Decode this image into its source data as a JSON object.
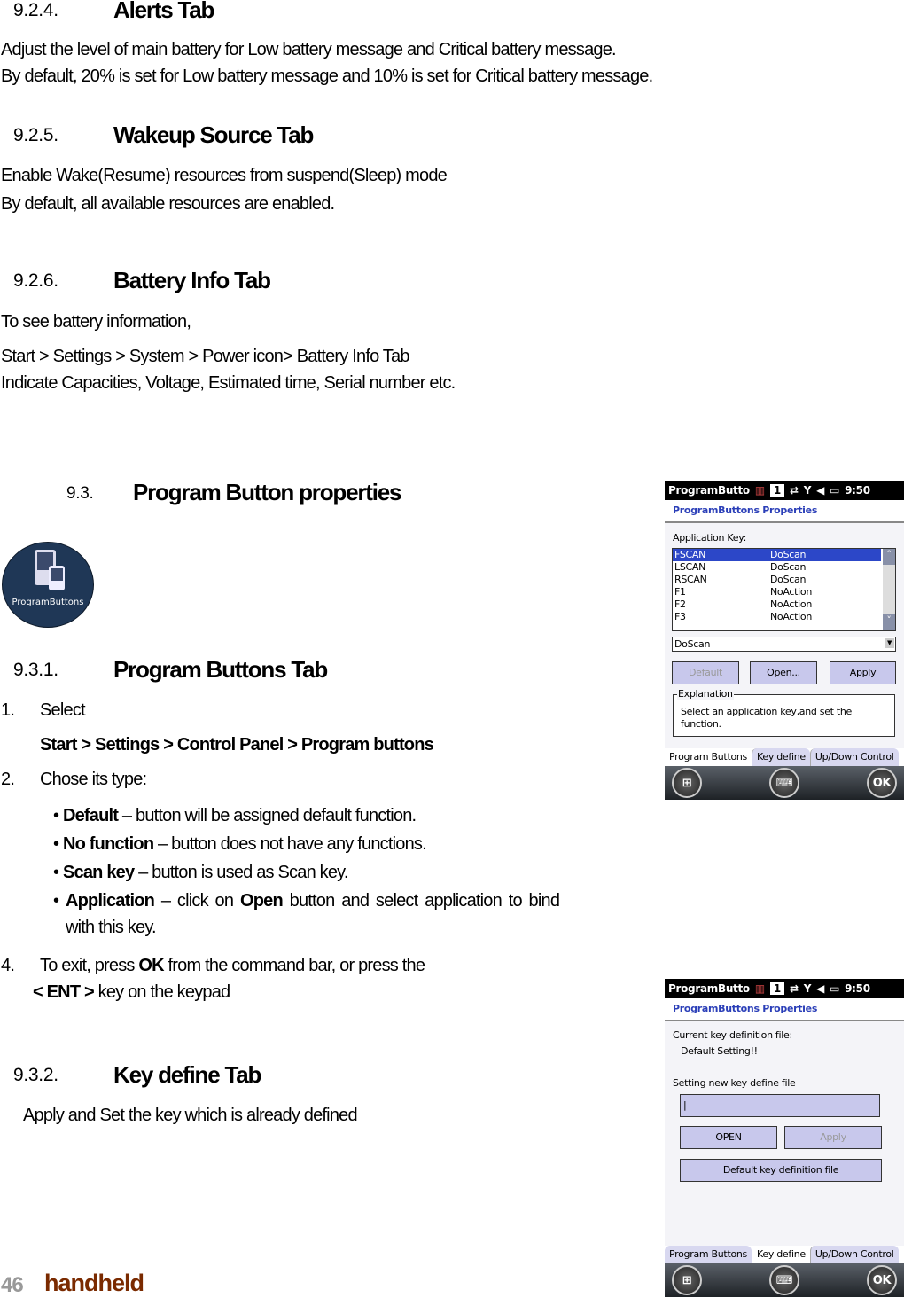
{
  "s924": {
    "num": "9.2.4.",
    "title": "Alerts Tab",
    "p1": "Adjust the level of main battery for Low battery message and Critical battery message.",
    "p2": "By default, 20% is set for Low battery message and 10% is set for Critical battery message."
  },
  "s925": {
    "num": "9.2.5.",
    "title": "Wakeup Source Tab",
    "p1": "Enable Wake(Resume) resources from suspend(Sleep) mode",
    "p2": "By default, all available resources are enabled."
  },
  "s926": {
    "num": "9.2.6.",
    "title": "Battery Info Tab",
    "p1": "To see battery information,",
    "p2": "Start > Settings > System > Power icon> Battery Info Tab",
    "p3": "Indicate Capacities, Voltage, Estimated time, Serial number etc."
  },
  "s93": {
    "num": "9.3.",
    "title": "Program Button properties",
    "icon_label": "ProgramButtons"
  },
  "s931": {
    "num": "9.3.1.",
    "title": "Program Buttons Tab",
    "i1n": "1.",
    "i1": "Select",
    "path": "Start > Settings > Control Panel > Program buttons",
    "i2n": "2.",
    "i2": "Chose its type:",
    "bullets": [
      {
        "b": "Default",
        "t": " – button will be assigned default function."
      },
      {
        "b": "No function",
        "t": " – button does not have any functions."
      },
      {
        "b": "Scan key",
        "t": " – button is used as Scan key."
      },
      {
        "b": "Application",
        "t": " – click on ",
        "b2": "Open",
        "t2": " button and select application to bind"
      }
    ],
    "cont": "with this key.",
    "i4n": "4.",
    "i4a": "To exit, press ",
    "i4b": "OK",
    "i4c": " from the command bar, or press the",
    "ent": "< ENT >",
    "entt": " key on the keypad"
  },
  "s932": {
    "num": "9.3.2.",
    "title": "Key define Tab",
    "p1": "Apply and Set the key which is already defined"
  },
  "footer": {
    "page": "46",
    "brand": "handheld"
  },
  "device": {
    "app": "ProgramButto",
    "num": "1",
    "time": "9:50",
    "title": "ProgramButtons Properties",
    "tabs": [
      "Program Buttons",
      "Key define",
      "Up/Down Control"
    ],
    "ok": "OK"
  },
  "screen1": {
    "label": "Application Key:",
    "rows": [
      [
        "FSCAN",
        "DoScan"
      ],
      [
        "LSCAN",
        "DoScan"
      ],
      [
        "RSCAN",
        "DoScan"
      ],
      [
        "F1",
        "NoAction"
      ],
      [
        "F2",
        "NoAction"
      ],
      [
        "F3",
        "NoAction"
      ]
    ],
    "selected": "DoScan",
    "btn_default": "Default",
    "btn_open": "Open...",
    "btn_apply": "Apply",
    "expl_label": "Explanation",
    "expl": "Select an application key,and set the function."
  },
  "screen2": {
    "cur_label": "Current key definition file:",
    "cur_val": "Default Setting!!",
    "new_label": "Setting new key define file",
    "input": "",
    "btn_open": "OPEN",
    "btn_apply": "Apply",
    "btn_default": "Default key definition file"
  },
  "colors": {
    "brand": "#7a2a00",
    "accent": "#2b3fb8",
    "button": "#c8c8ec"
  }
}
